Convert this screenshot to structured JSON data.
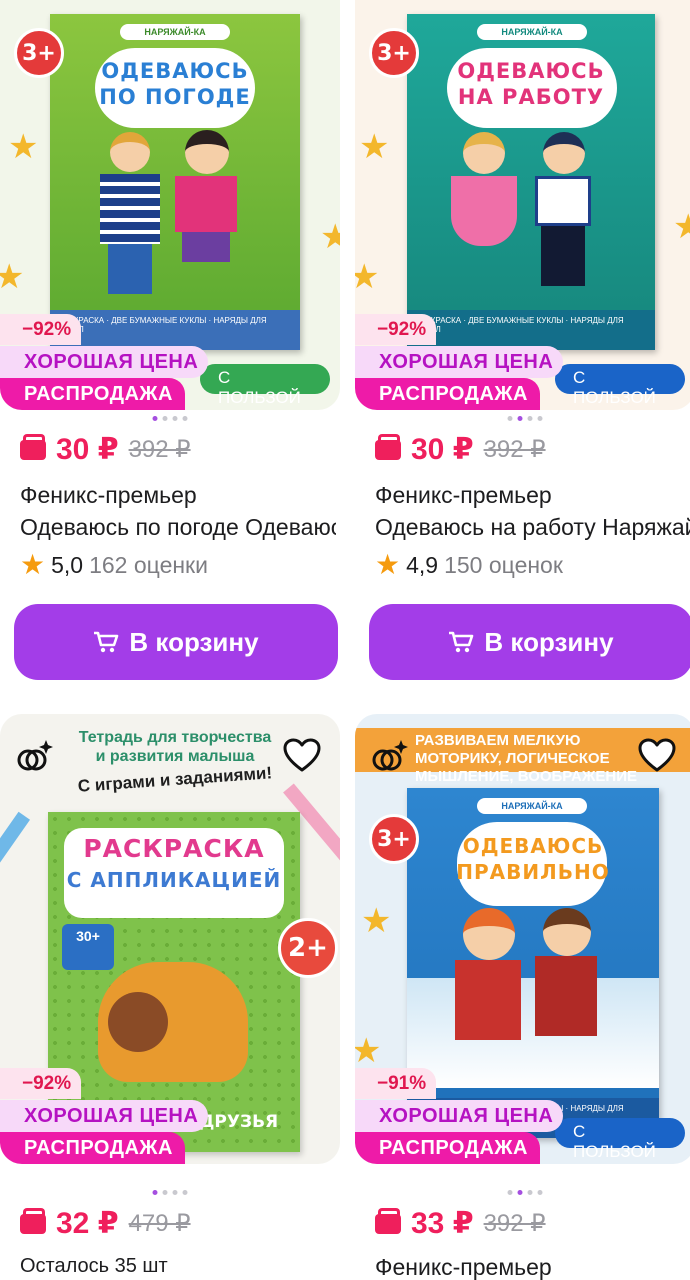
{
  "colors": {
    "accent": "#a33de8",
    "price": "#ef1f5c",
    "sale": "#ee1ba8",
    "good_price": "#b512c2"
  },
  "products": [
    {
      "cover": {
        "brand": "НАРЯЖАЙ-КА",
        "title1": "ОДЕВАЮСЬ",
        "title2": "ПО ПОГОДЕ",
        "age": "3+",
        "footer": "РАСКРАСКА · ДВЕ БУМАЖНЫЕ КУКЛЫ · НАРЯДЫ ДЛЯ КУКОЛ",
        "benefit": "С ПОЛЬЗОЙ"
      },
      "discount": "−92%",
      "good_price": "ХОРОШАЯ ЦЕНА",
      "sale": "РАСПРОДАЖА",
      "price": "30 ₽",
      "old_price": "392 ₽",
      "line1": "Феникс-премьер",
      "line2": "Одеваюсь по погоде Одеваюсь по погоде",
      "rating": "5,0",
      "reviews": "162 оценки",
      "cart": "В корзину"
    },
    {
      "cover": {
        "brand": "НАРЯЖАЙ-КА",
        "title1": "ОДЕВАЮСЬ",
        "title2": "НА РАБОТУ",
        "age": "3+",
        "footer": "РАСКРАСКА · ДВЕ БУМАЖНЫЕ КУКЛЫ · НАРЯДЫ ДЛЯ КУКОЛ",
        "benefit": "С ПОЛЬЗОЙ"
      },
      "discount": "−92%",
      "good_price": "ХОРОШАЯ ЦЕНА",
      "sale": "РАСПРОДАЖА",
      "price": "30 ₽",
      "old_price": "392 ₽",
      "line1": "Феникс-премьер",
      "line2": "Одеваюсь на работу Наряжай-ка",
      "rating": "4,9",
      "reviews": "150 оценок",
      "cart": "В корзину"
    },
    {
      "cover": {
        "top1": "Тетрадь для творчества",
        "top2": "и развития малыша",
        "top3": "С играми и заданиями!",
        "title1": "РАСКРАСКА",
        "title2": "С АППЛИКАЦИЕЙ",
        "age": "2+",
        "sticker": "30+",
        "bottom": "ЁЖИК И ЕГО ДРУЗЬЯ"
      },
      "discount": "−92%",
      "good_price": "ХОРОШАЯ ЦЕНА",
      "sale": "РАСПРОДАЖА",
      "price": "32 ₽",
      "old_price": "479 ₽",
      "line1": "Осталось 35 шт"
    },
    {
      "cover": {
        "top": "РАЗВИВАЕМ МЕЛКУЮ МОТОРИКУ, ЛОГИЧЕСКОЕ МЫШЛЕНИЕ, ВООБРАЖЕНИЕ",
        "brand": "НАРЯЖАЙ-КА",
        "title1": "ОДЕВАЮСЬ",
        "title2": "ПРАВИЛЬНО",
        "age": "3+",
        "footer": "РАСКРАСКА · ДВЕ БУМАЖНЫЕ КУКЛЫ · НАРЯДЫ ДЛЯ КУКОЛ",
        "benefit": "С ПОЛЬЗОЙ"
      },
      "discount": "−91%",
      "good_price": "ХОРОШАЯ ЦЕНА",
      "sale": "РАСПРОДАЖА",
      "price": "33 ₽",
      "old_price": "392 ₽",
      "line1": "Феникс-премьер"
    }
  ]
}
